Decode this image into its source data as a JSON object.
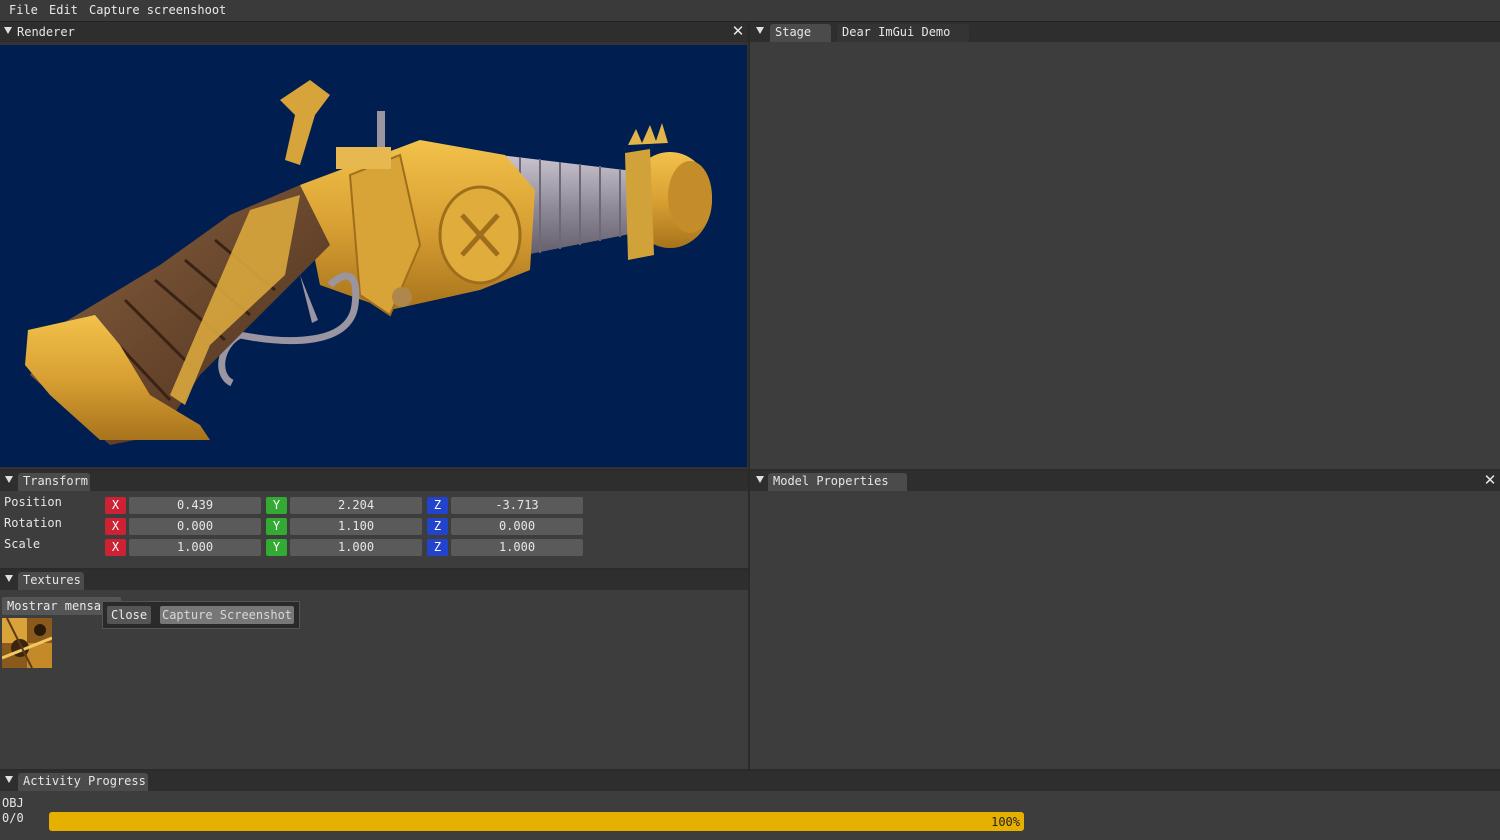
{
  "menu": {
    "items": [
      "File",
      "Edit",
      "Capture screenshoot"
    ]
  },
  "renderer": {
    "title": "Renderer",
    "close": "✕"
  },
  "stage": {
    "tabs": [
      "Stage",
      "Dear ImGui Demo"
    ]
  },
  "transform": {
    "tab": "Transform",
    "rows": [
      {
        "label": "Position",
        "x": "0.439",
        "y": "2.204",
        "z": "-3.713"
      },
      {
        "label": "Rotation",
        "x": "0.000",
        "y": "1.100",
        "z": "0.000"
      },
      {
        "label": "Scale",
        "x": "1.000",
        "y": "1.000",
        "z": "1.000"
      }
    ],
    "axes": {
      "x": "X",
      "y": "Y",
      "z": "Z"
    }
  },
  "model_properties": {
    "tab": "Model Properties",
    "close": "✕"
  },
  "textures": {
    "tab": "Textures",
    "show_button": "Mostrar mensa",
    "popup": {
      "close": "Close",
      "capture": "Capture Screenshot"
    },
    "thumbnail_icon": "texture-thumbnail"
  },
  "activity": {
    "tab": "Activity Progress",
    "job": "OBJ",
    "count": "0/0",
    "progress": 1.0,
    "progress_label": "100%"
  },
  "colors": {
    "viewport_bg": "#001e50",
    "axis_x": "#cc2233",
    "axis_y": "#33aa33",
    "axis_z": "#2244cc",
    "progress": "#e6b000"
  }
}
